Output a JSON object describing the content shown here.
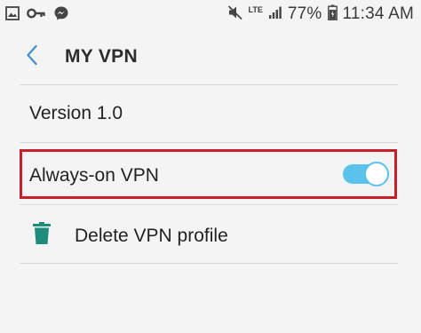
{
  "status_bar": {
    "icons_left": [
      "image-icon",
      "key-icon",
      "messenger-icon"
    ],
    "icons_right": [
      "mute-icon",
      "lte-icon",
      "signal-icon",
      "battery-icon"
    ],
    "lte_label": "LTE",
    "battery_percent": "77%",
    "time": "11:34 AM"
  },
  "header": {
    "back_icon": "chevron-left-icon",
    "title": "MY VPN"
  },
  "settings": {
    "version": "Version 1.0",
    "always_on": {
      "label": "Always-on VPN",
      "enabled": true,
      "accent_color": "#5bc3ea",
      "highlight_color": "#c8202a"
    },
    "delete": {
      "icon": "trash-icon",
      "label": "Delete VPN profile",
      "icon_color": "#1e8c78"
    }
  }
}
